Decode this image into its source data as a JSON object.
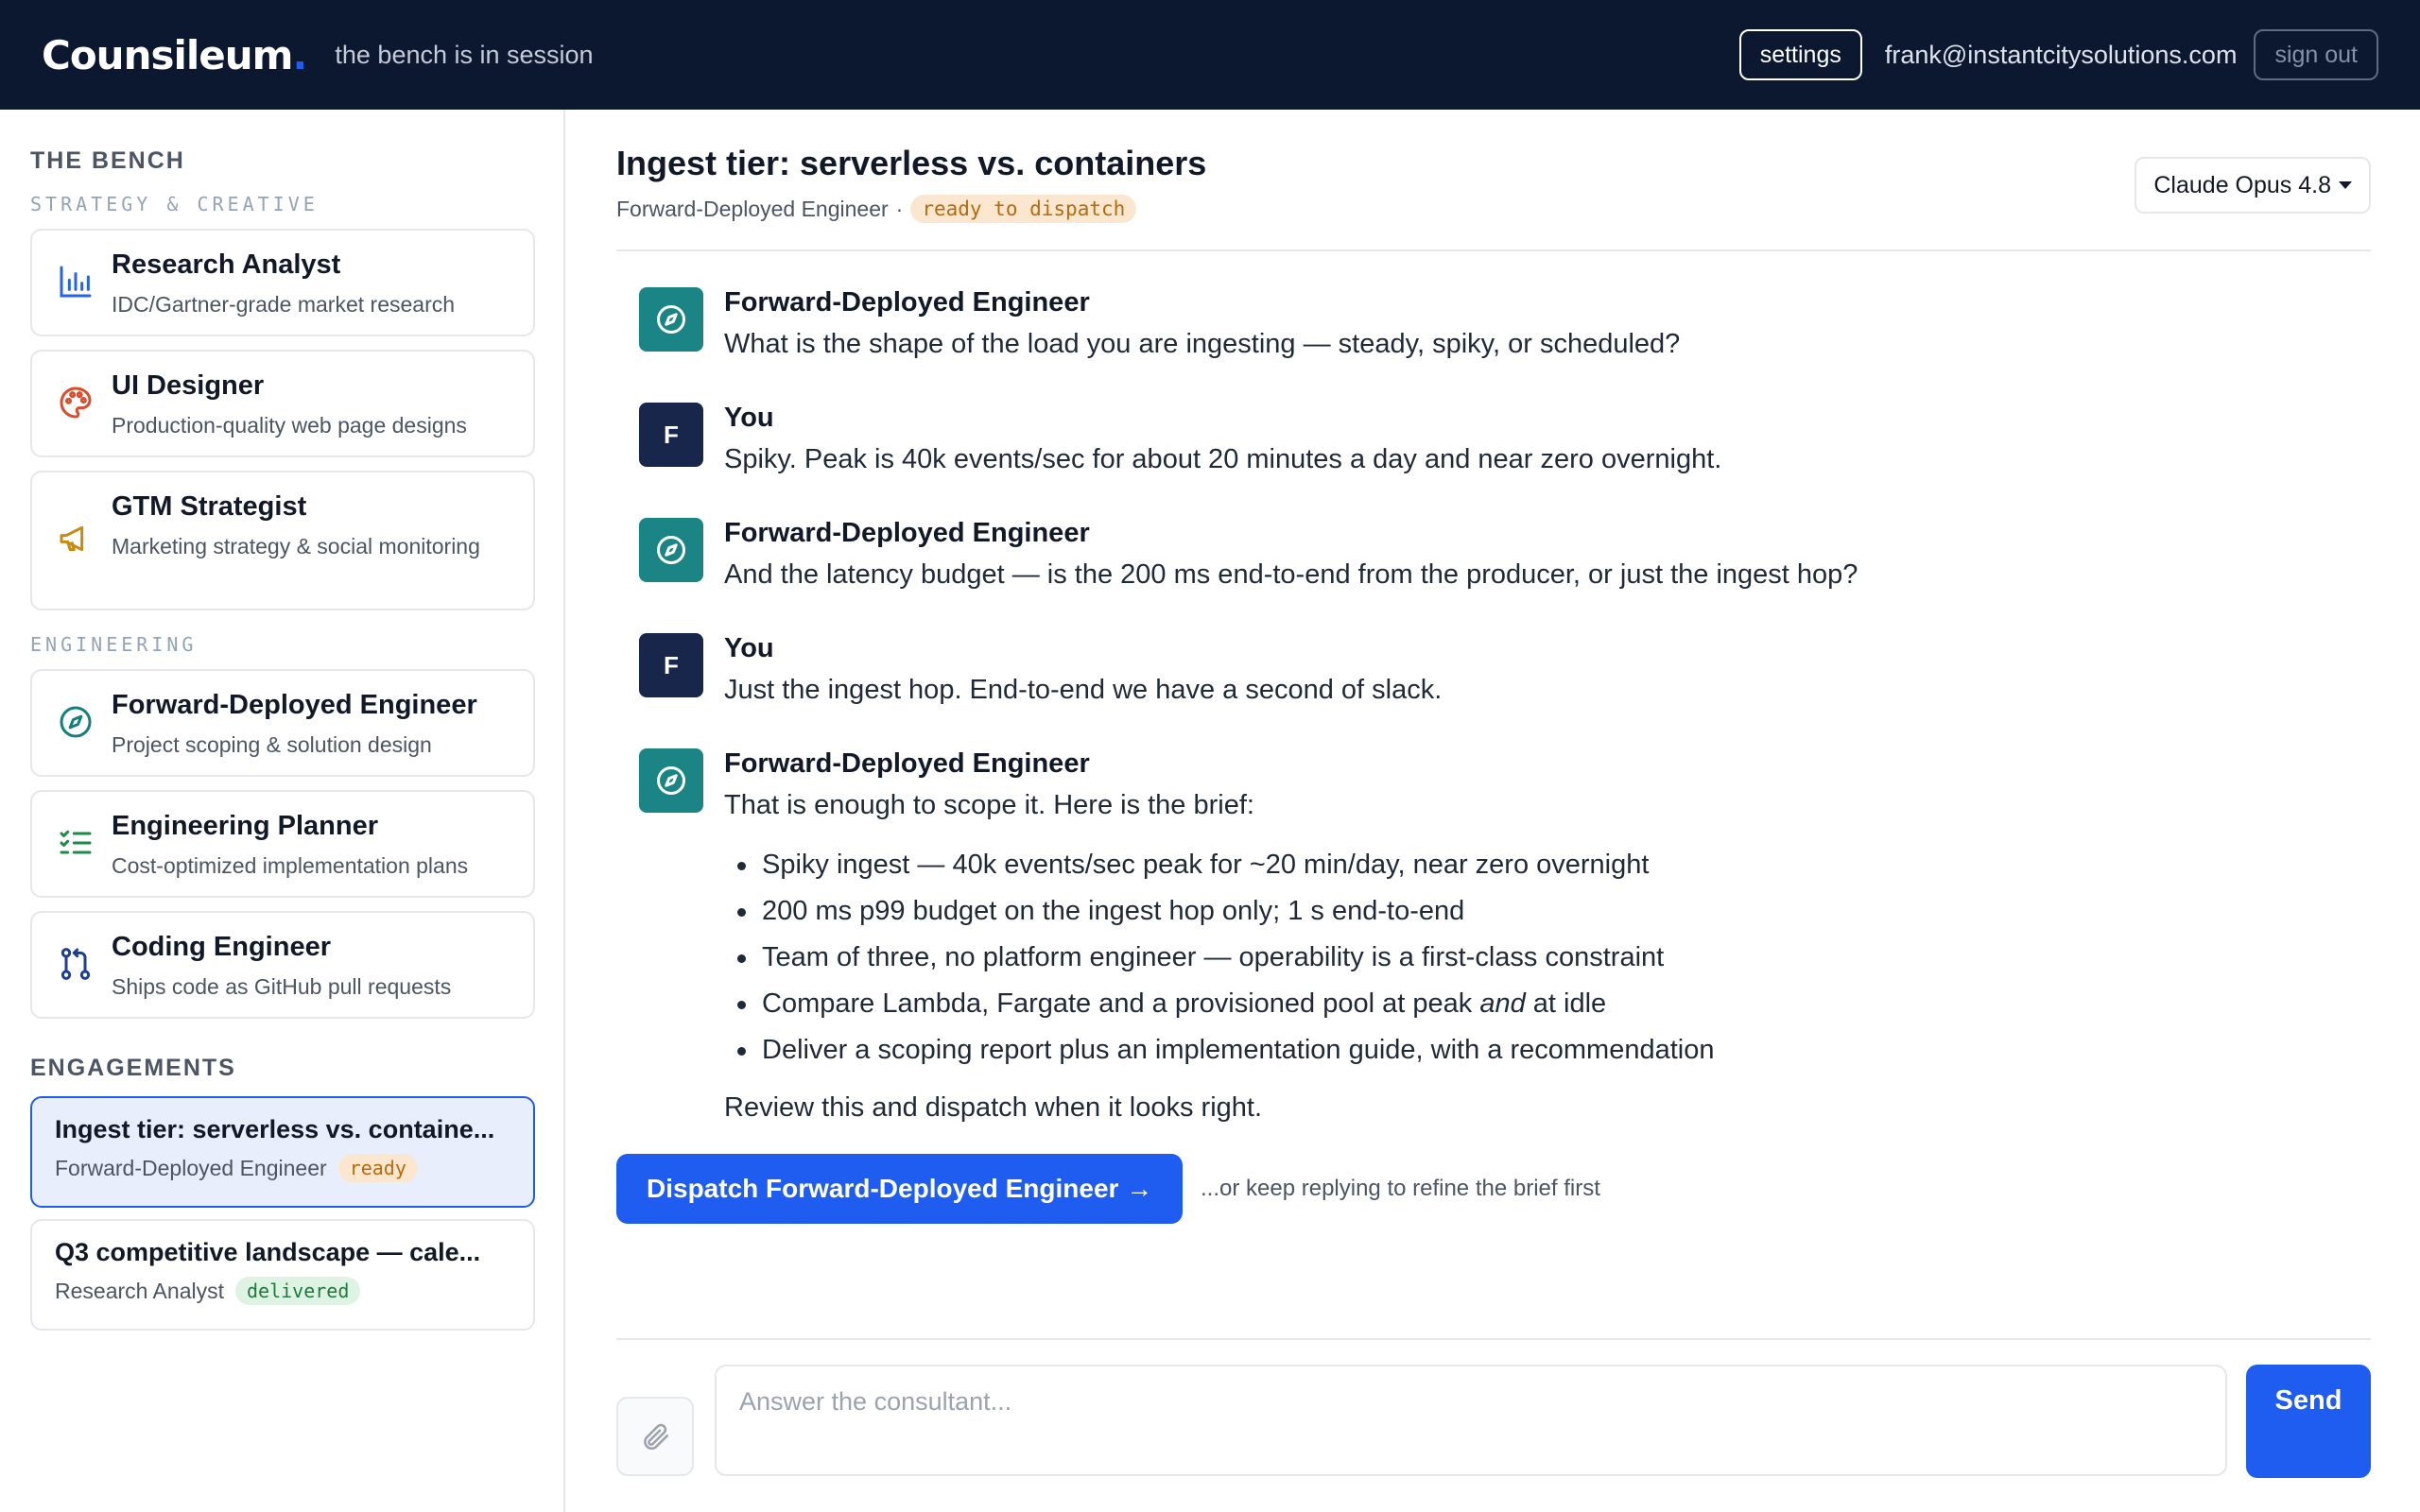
{
  "header": {
    "logo": "Counsileum",
    "logo_dot": ".",
    "tagline": "the bench is in session",
    "settings_label": "settings",
    "user_email": "frank@instantcitysolutions.com",
    "signout_label": "sign out",
    "colors": {
      "background": "#0c1730",
      "accent": "#1f5cf0"
    }
  },
  "sidebar": {
    "bench_title": "THE BENCH",
    "groups": [
      {
        "label": "STRATEGY & CREATIVE",
        "consultants": [
          {
            "name": "Research Analyst",
            "desc": "IDC/Gartner-grade market research",
            "icon": "bar-chart-icon",
            "color": "#2563eb"
          },
          {
            "name": "UI Designer",
            "desc": "Production-quality web page designs",
            "icon": "palette-icon",
            "color": "#dc4c2a"
          },
          {
            "name": "GTM Strategist",
            "desc": "Marketing strategy & social monitoring",
            "icon": "megaphone-icon",
            "color": "#c98a12"
          }
        ]
      },
      {
        "label": "ENGINEERING",
        "consultants": [
          {
            "name": "Forward-Deployed Engineer",
            "desc": "Project scoping & solution design",
            "icon": "compass-icon",
            "color": "#13807a"
          },
          {
            "name": "Engineering Planner",
            "desc": "Cost-optimized implementation plans",
            "icon": "checklist-icon",
            "color": "#1c8a48"
          },
          {
            "name": "Coding Engineer",
            "desc": "Ships code as GitHub pull requests",
            "icon": "git-pull-request-icon",
            "color": "#1e3f8f"
          }
        ]
      }
    ],
    "engagements_title": "ENGAGEMENTS",
    "engagements": [
      {
        "title": "Ingest tier: serverless vs. containe...",
        "consultant": "Forward-Deployed Engineer",
        "status": "ready",
        "active": true
      },
      {
        "title": "Q3 competitive landscape — cale...",
        "consultant": "Research Analyst",
        "status": "delivered",
        "active": false
      }
    ]
  },
  "conversation": {
    "title": "Ingest tier: serverless vs. containers",
    "consultant": "Forward-Deployed Engineer",
    "separator": "·",
    "status": "ready to dispatch",
    "model": "Claude Opus 4.8",
    "messages": [
      {
        "author": "Forward-Deployed Engineer",
        "role": "bot",
        "text": "What is the shape of the load you are ingesting — steady, spiky, or scheduled?"
      },
      {
        "author": "You",
        "role": "user",
        "initial": "F",
        "text": "Spiky. Peak is 40k events/sec for about 20 minutes a day and near zero overnight."
      },
      {
        "author": "Forward-Deployed Engineer",
        "role": "bot",
        "text": "And the latency budget — is the 200 ms end-to-end from the producer, or just the ingest hop?"
      },
      {
        "author": "You",
        "role": "user",
        "initial": "F",
        "text": "Just the ingest hop. End-to-end we have a second of slack."
      },
      {
        "author": "Forward-Deployed Engineer",
        "role": "bot",
        "text": "That is enough to scope it. Here is the brief:",
        "bullets": [
          "Spiky ingest — 40k events/sec peak for ~20 min/day, near zero overnight",
          "200 ms p99 budget on the ingest hop only; 1 s end-to-end",
          "Team of three, no platform engineer — operability is a first-class constraint",
          {
            "before": "Compare Lambda, Fargate and a provisioned pool at peak ",
            "em": "and",
            "after": " at idle"
          },
          "Deliver a scoping report plus an implementation guide, with a recommendation"
        ],
        "closing": "Review this and dispatch when it looks right."
      }
    ],
    "dispatch_label": "Dispatch Forward-Deployed Engineer →",
    "dispatch_hint": "...or keep replying to refine the brief first"
  },
  "composer": {
    "placeholder": "Answer the consultant...",
    "value": "",
    "send_label": "Send"
  }
}
